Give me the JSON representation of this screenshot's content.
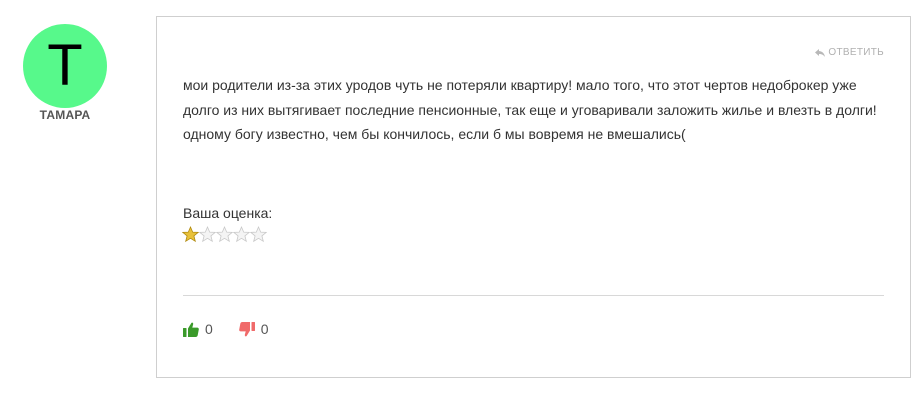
{
  "author": {
    "initial": "T",
    "name": "ТАМАРА",
    "avatar_color": "#57f98b"
  },
  "comment": {
    "reply_label": "ОТВЕТИТЬ",
    "text": "мои родители из-за этих уродов чуть не потеряли квартиру! мало того, что этот чертов недоброкер уже долго из них вытягивает последние пенсионные, так еще и уговаривали заложить жилье и влезть в долги! одному богу известно, чем бы кончилось, если б мы вовремя не вмешались(",
    "rating_label": "Ваша оценка:",
    "rating": 1,
    "rating_max": 5
  },
  "votes": {
    "likes": "0",
    "dislikes": "0",
    "like_color": "#3a9a2a",
    "dislike_color": "#f06a6a"
  }
}
